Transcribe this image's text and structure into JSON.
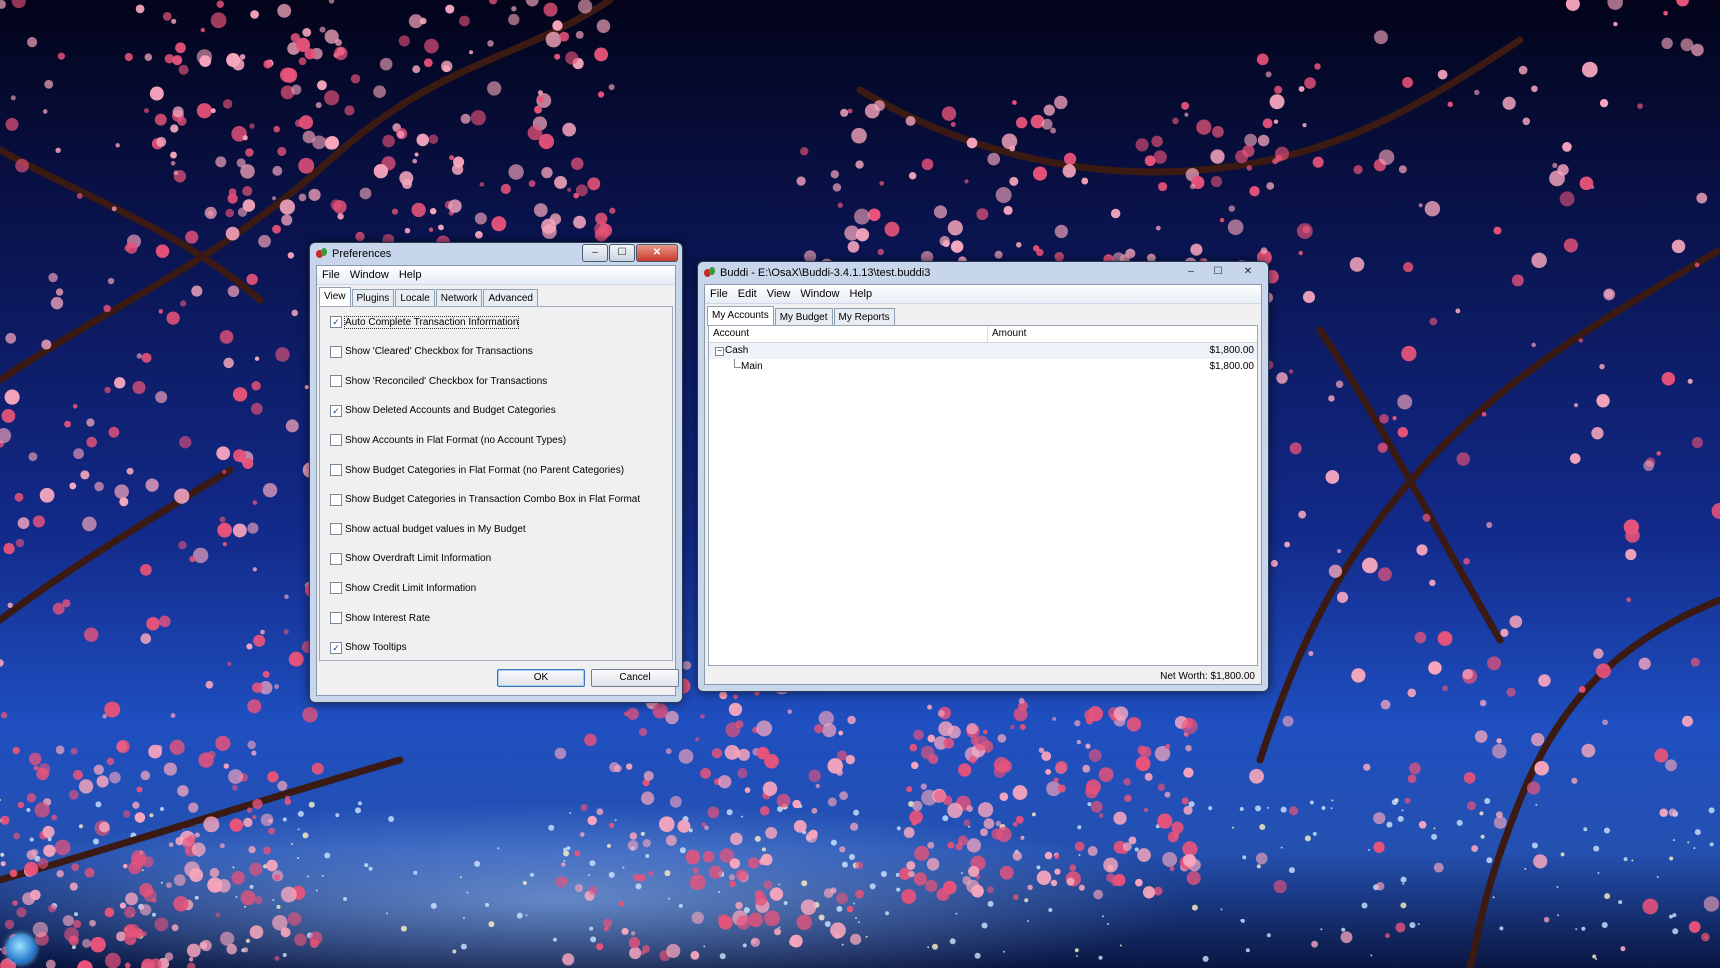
{
  "preferences": {
    "title": "Preferences",
    "menu": [
      "File",
      "Window",
      "Help"
    ],
    "tabs": [
      "View",
      "Plugins",
      "Locale",
      "Network",
      "Advanced"
    ],
    "active_tab": "View",
    "options": [
      {
        "label": "Auto Complete Transaction Information",
        "checked": true
      },
      {
        "label": "Show 'Cleared' Checkbox for Transactions",
        "checked": false
      },
      {
        "label": "Show 'Reconciled' Checkbox for Transactions",
        "checked": false
      },
      {
        "label": "Show Deleted Accounts and Budget Categories",
        "checked": true
      },
      {
        "label": "Show Accounts in Flat Format (no Account Types)",
        "checked": false
      },
      {
        "label": "Show Budget Categories in Flat Format (no Parent Categories)",
        "checked": false
      },
      {
        "label": "Show Budget Categories in Transaction Combo Box in Flat Format",
        "checked": false
      },
      {
        "label": "Show actual budget values in My Budget",
        "checked": false
      },
      {
        "label": "Show Overdraft Limit Information",
        "checked": false
      },
      {
        "label": "Show Credit Limit Information",
        "checked": false
      },
      {
        "label": "Show Interest Rate",
        "checked": false
      },
      {
        "label": "Show Tooltips",
        "checked": true
      }
    ],
    "ok_label": "OK",
    "cancel_label": "Cancel"
  },
  "buddi": {
    "title": "Buddi - E:\\OsaX\\Buddi-3.4.1.13\\test.buddi3",
    "menu": [
      "File",
      "Edit",
      "View",
      "Window",
      "Help"
    ],
    "tabs": [
      "My Accounts",
      "My Budget",
      "My Reports"
    ],
    "active_tab": "My Accounts",
    "columns": [
      "Account",
      "Amount"
    ],
    "rows": [
      {
        "name": "Cash",
        "amount": "$1,800.00",
        "level": 0
      },
      {
        "name": "Main",
        "amount": "$1,800.00",
        "level": 1
      }
    ],
    "status": "Net Worth: $1,800.00"
  },
  "window_controls": {
    "minimize": "–",
    "maximize": "☐",
    "close": "✕"
  },
  "colors": {
    "blossom": "#e8537a",
    "blossom_light": "#f7a6bd",
    "branch": "#3a1a12"
  }
}
